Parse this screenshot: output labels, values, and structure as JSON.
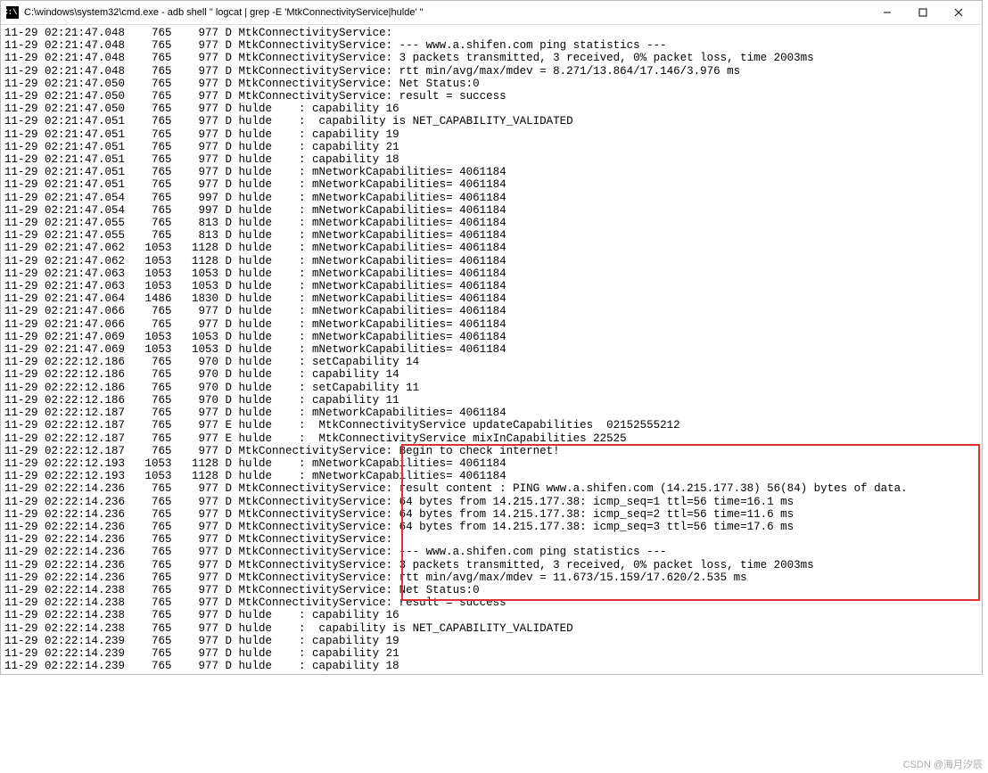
{
  "window": {
    "title": "C:\\windows\\system32\\cmd.exe - adb  shell \" logcat | grep  -E 'MtkConnectivityService|hulde'  \"",
    "cmd_icon_text": "C:\\.",
    "buttons": {
      "min": "minimize",
      "max": "maximize",
      "close": "close"
    }
  },
  "highlight": {
    "top_line_index": 40,
    "bottom_line_index": 51
  },
  "log": [
    "11-29 02:21:47.048    765    977 D MtkConnectivityService:",
    "11-29 02:21:47.048    765    977 D MtkConnectivityService: --- www.a.shifen.com ping statistics ---",
    "11-29 02:21:47.048    765    977 D MtkConnectivityService: 3 packets transmitted, 3 received, 0% packet loss, time 2003ms",
    "11-29 02:21:47.048    765    977 D MtkConnectivityService: rtt min/avg/max/mdev = 8.271/13.864/17.146/3.976 ms",
    "11-29 02:21:47.050    765    977 D MtkConnectivityService: Net Status:0",
    "11-29 02:21:47.050    765    977 D MtkConnectivityService: result = success",
    "11-29 02:21:47.050    765    977 D hulde    : capability 16",
    "11-29 02:21:47.051    765    977 D hulde    :  capability is NET_CAPABILITY_VALIDATED",
    "11-29 02:21:47.051    765    977 D hulde    : capability 19",
    "11-29 02:21:47.051    765    977 D hulde    : capability 21",
    "11-29 02:21:47.051    765    977 D hulde    : capability 18",
    "11-29 02:21:47.051    765    977 D hulde    : mNetworkCapabilities= 4061184",
    "11-29 02:21:47.051    765    977 D hulde    : mNetworkCapabilities= 4061184",
    "11-29 02:21:47.054    765    997 D hulde    : mNetworkCapabilities= 4061184",
    "11-29 02:21:47.054    765    997 D hulde    : mNetworkCapabilities= 4061184",
    "11-29 02:21:47.055    765    813 D hulde    : mNetworkCapabilities= 4061184",
    "11-29 02:21:47.055    765    813 D hulde    : mNetworkCapabilities= 4061184",
    "11-29 02:21:47.062   1053   1128 D hulde    : mNetworkCapabilities= 4061184",
    "11-29 02:21:47.062   1053   1128 D hulde    : mNetworkCapabilities= 4061184",
    "11-29 02:21:47.063   1053   1053 D hulde    : mNetworkCapabilities= 4061184",
    "11-29 02:21:47.063   1053   1053 D hulde    : mNetworkCapabilities= 4061184",
    "11-29 02:21:47.064   1486   1830 D hulde    : mNetworkCapabilities= 4061184",
    "11-29 02:21:47.066    765    977 D hulde    : mNetworkCapabilities= 4061184",
    "11-29 02:21:47.066    765    977 D hulde    : mNetworkCapabilities= 4061184",
    "11-29 02:21:47.069   1053   1053 D hulde    : mNetworkCapabilities= 4061184",
    "11-29 02:21:47.069   1053   1053 D hulde    : mNetworkCapabilities= 4061184",
    "11-29 02:22:12.186    765    970 D hulde    : setCapability 14",
    "11-29 02:22:12.186    765    970 D hulde    : capability 14",
    "11-29 02:22:12.186    765    970 D hulde    : setCapability 11",
    "11-29 02:22:12.186    765    970 D hulde    : capability 11",
    "11-29 02:22:12.187    765    977 D hulde    : mNetworkCapabilities= 4061184",
    "11-29 02:22:12.187    765    977 E hulde    :  MtkConnectivityService updateCapabilities  02152555212",
    "11-29 02:22:12.187    765    977 E hulde    :  MtkConnectivityService mixInCapabilities 22525",
    "11-29 02:22:12.187    765    977 D MtkConnectivityService: Begin to check internet!",
    "11-29 02:22:12.193   1053   1128 D hulde    : mNetworkCapabilities= 4061184",
    "11-29 02:22:12.193   1053   1128 D hulde    : mNetworkCapabilities= 4061184",
    "11-29 02:22:14.236    765    977 D MtkConnectivityService: result content : PING www.a.shifen.com (14.215.177.38) 56(84) bytes of data.",
    "11-29 02:22:14.236    765    977 D MtkConnectivityService: 64 bytes from 14.215.177.38: icmp_seq=1 ttl=56 time=16.1 ms",
    "11-29 02:22:14.236    765    977 D MtkConnectivityService: 64 bytes from 14.215.177.38: icmp_seq=2 ttl=56 time=11.6 ms",
    "11-29 02:22:14.236    765    977 D MtkConnectivityService: 64 bytes from 14.215.177.38: icmp_seq=3 ttl=56 time=17.6 ms",
    "11-29 02:22:14.236    765    977 D MtkConnectivityService:",
    "11-29 02:22:14.236    765    977 D MtkConnectivityService: --- www.a.shifen.com ping statistics ---",
    "11-29 02:22:14.236    765    977 D MtkConnectivityService: 3 packets transmitted, 3 received, 0% packet loss, time 2003ms",
    "11-29 02:22:14.236    765    977 D MtkConnectivityService: rtt min/avg/max/mdev = 11.673/15.159/17.620/2.535 ms",
    "11-29 02:22:14.238    765    977 D MtkConnectivityService: Net Status:0",
    "11-29 02:22:14.238    765    977 D MtkConnectivityService: result = success",
    "11-29 02:22:14.238    765    977 D hulde    : capability 16",
    "11-29 02:22:14.238    765    977 D hulde    :  capability is NET_CAPABILITY_VALIDATED",
    "11-29 02:22:14.239    765    977 D hulde    : capability 19",
    "11-29 02:22:14.239    765    977 D hulde    : capability 21",
    "11-29 02:22:14.239    765    977 D hulde    : capability 18"
  ],
  "watermark": "CSDN @海月汐辰"
}
